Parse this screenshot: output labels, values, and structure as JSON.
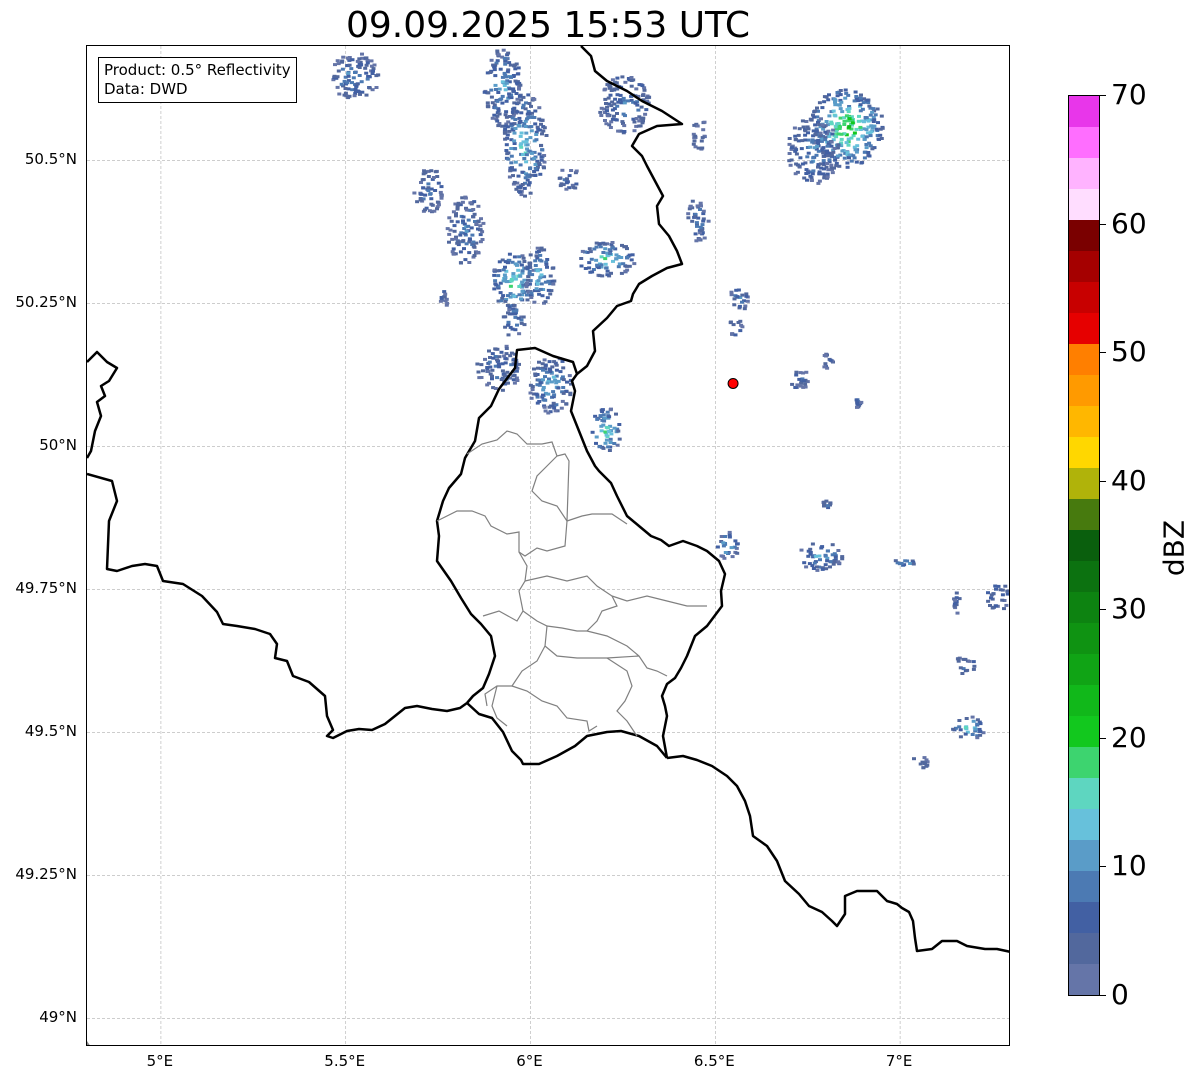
{
  "title": "09.09.2025 15:53 UTC",
  "info_box": {
    "product_line": "Product: 0.5° Reflectivity",
    "data_line": "Data: DWD"
  },
  "map": {
    "lon_range": [
      4.8,
      7.3
    ],
    "lat_range": [
      48.95,
      50.7
    ],
    "lat_ticks": [
      {
        "value": 50.5,
        "label": "50.5°N"
      },
      {
        "value": 50.25,
        "label": "50.25°N"
      },
      {
        "value": 50.0,
        "label": "50°N"
      },
      {
        "value": 49.75,
        "label": "49.75°N"
      },
      {
        "value": 49.5,
        "label": "49.5°N"
      },
      {
        "value": 49.25,
        "label": "49.25°N"
      },
      {
        "value": 49.0,
        "label": "49°N"
      }
    ],
    "lon_ticks": [
      {
        "value": 5.0,
        "label": "5°E"
      },
      {
        "value": 5.5,
        "label": "5.5°E"
      },
      {
        "value": 6.0,
        "label": "6°E"
      },
      {
        "value": 6.5,
        "label": "6.5°E"
      },
      {
        "value": 7.0,
        "label": "7°E"
      }
    ],
    "gridlines": true,
    "radar_site": {
      "lon": 6.548,
      "lat": 50.11,
      "color": "#ff0000"
    },
    "echoes": [
      {
        "lon": 5.52,
        "lat": 50.65,
        "rx": 0.07,
        "ry": 0.04,
        "dbz": 10
      },
      {
        "lon": 5.92,
        "lat": 50.63,
        "rx": 0.05,
        "ry": 0.07,
        "dbz": 12
      },
      {
        "lon": 5.98,
        "lat": 50.53,
        "rx": 0.06,
        "ry": 0.09,
        "dbz": 15
      },
      {
        "lon": 5.72,
        "lat": 50.45,
        "rx": 0.04,
        "ry": 0.04,
        "dbz": 8
      },
      {
        "lon": 5.82,
        "lat": 50.38,
        "rx": 0.05,
        "ry": 0.06,
        "dbz": 10
      },
      {
        "lon": 5.95,
        "lat": 50.29,
        "rx": 0.06,
        "ry": 0.05,
        "dbz": 18
      },
      {
        "lon": 6.02,
        "lat": 50.3,
        "rx": 0.04,
        "ry": 0.05,
        "dbz": 14
      },
      {
        "lon": 6.2,
        "lat": 50.33,
        "rx": 0.08,
        "ry": 0.03,
        "dbz": 16
      },
      {
        "lon": 6.25,
        "lat": 50.6,
        "rx": 0.07,
        "ry": 0.05,
        "dbz": 10
      },
      {
        "lon": 6.1,
        "lat": 50.47,
        "rx": 0.03,
        "ry": 0.02,
        "dbz": 8
      },
      {
        "lon": 5.95,
        "lat": 50.22,
        "rx": 0.03,
        "ry": 0.03,
        "dbz": 12
      },
      {
        "lon": 5.76,
        "lat": 50.26,
        "rx": 0.01,
        "ry": 0.02,
        "dbz": 7
      },
      {
        "lon": 6.45,
        "lat": 50.4,
        "rx": 0.03,
        "ry": 0.04,
        "dbz": 8
      },
      {
        "lon": 6.45,
        "lat": 50.55,
        "rx": 0.02,
        "ry": 0.03,
        "dbz": 7
      },
      {
        "lon": 5.91,
        "lat": 50.14,
        "rx": 0.06,
        "ry": 0.04,
        "dbz": 9
      },
      {
        "lon": 6.05,
        "lat": 50.11,
        "rx": 0.06,
        "ry": 0.05,
        "dbz": 13
      },
      {
        "lon": 6.2,
        "lat": 50.03,
        "rx": 0.04,
        "ry": 0.04,
        "dbz": 18
      },
      {
        "lon": 6.85,
        "lat": 50.56,
        "rx": 0.1,
        "ry": 0.07,
        "dbz": 22
      },
      {
        "lon": 6.76,
        "lat": 50.52,
        "rx": 0.07,
        "ry": 0.06,
        "dbz": 10
      },
      {
        "lon": 6.56,
        "lat": 50.26,
        "rx": 0.03,
        "ry": 0.02,
        "dbz": 9
      },
      {
        "lon": 6.55,
        "lat": 50.21,
        "rx": 0.02,
        "ry": 0.015,
        "dbz": 8
      },
      {
        "lon": 6.72,
        "lat": 50.12,
        "rx": 0.03,
        "ry": 0.02,
        "dbz": 7
      },
      {
        "lon": 6.8,
        "lat": 50.15,
        "rx": 0.015,
        "ry": 0.015,
        "dbz": 7
      },
      {
        "lon": 6.78,
        "lat": 49.81,
        "rx": 0.06,
        "ry": 0.025,
        "dbz": 12
      },
      {
        "lon": 6.53,
        "lat": 49.83,
        "rx": 0.03,
        "ry": 0.025,
        "dbz": 14
      },
      {
        "lon": 6.8,
        "lat": 49.9,
        "rx": 0.015,
        "ry": 0.01,
        "dbz": 8
      },
      {
        "lon": 7.01,
        "lat": 49.8,
        "rx": 0.03,
        "ry": 0.01,
        "dbz": 14
      },
      {
        "lon": 7.26,
        "lat": 49.74,
        "rx": 0.03,
        "ry": 0.025,
        "dbz": 9
      },
      {
        "lon": 7.15,
        "lat": 49.73,
        "rx": 0.01,
        "ry": 0.02,
        "dbz": 8
      },
      {
        "lon": 7.17,
        "lat": 49.62,
        "rx": 0.03,
        "ry": 0.015,
        "dbz": 8
      },
      {
        "lon": 7.18,
        "lat": 49.51,
        "rx": 0.045,
        "ry": 0.02,
        "dbz": 16
      },
      {
        "lon": 7.05,
        "lat": 49.45,
        "rx": 0.025,
        "ry": 0.01,
        "dbz": 8
      },
      {
        "lon": 6.88,
        "lat": 50.08,
        "rx": 0.01,
        "ry": 0.01,
        "dbz": 7
      }
    ]
  },
  "colorbar": {
    "min": 0,
    "max": 70,
    "step": 2.5,
    "unit_label": "dBZ",
    "tick_values": [
      0,
      10,
      20,
      30,
      40,
      50,
      60,
      70
    ],
    "tick_labels": [
      "0",
      "10",
      "20",
      "30",
      "40",
      "50",
      "60",
      "70"
    ],
    "colors": [
      "#6575a8",
      "#52689d",
      "#4260a3",
      "#4c7ab3",
      "#5a9cc8",
      "#67c1db",
      "#5ed6c0",
      "#3dd46f",
      "#12c81e",
      "#11b81a",
      "#10a415",
      "#0f9312",
      "#0d8311",
      "#0c7210",
      "#0a5f0d",
      "#477a0e",
      "#b0b30a",
      "#ffd700",
      "#ffb700",
      "#ff9a00",
      "#ff7f00",
      "#e60000",
      "#c80000",
      "#a50000",
      "#7a0000",
      "#ffddff",
      "#ffb3ff",
      "#ff6eff",
      "#e836ea"
    ]
  }
}
